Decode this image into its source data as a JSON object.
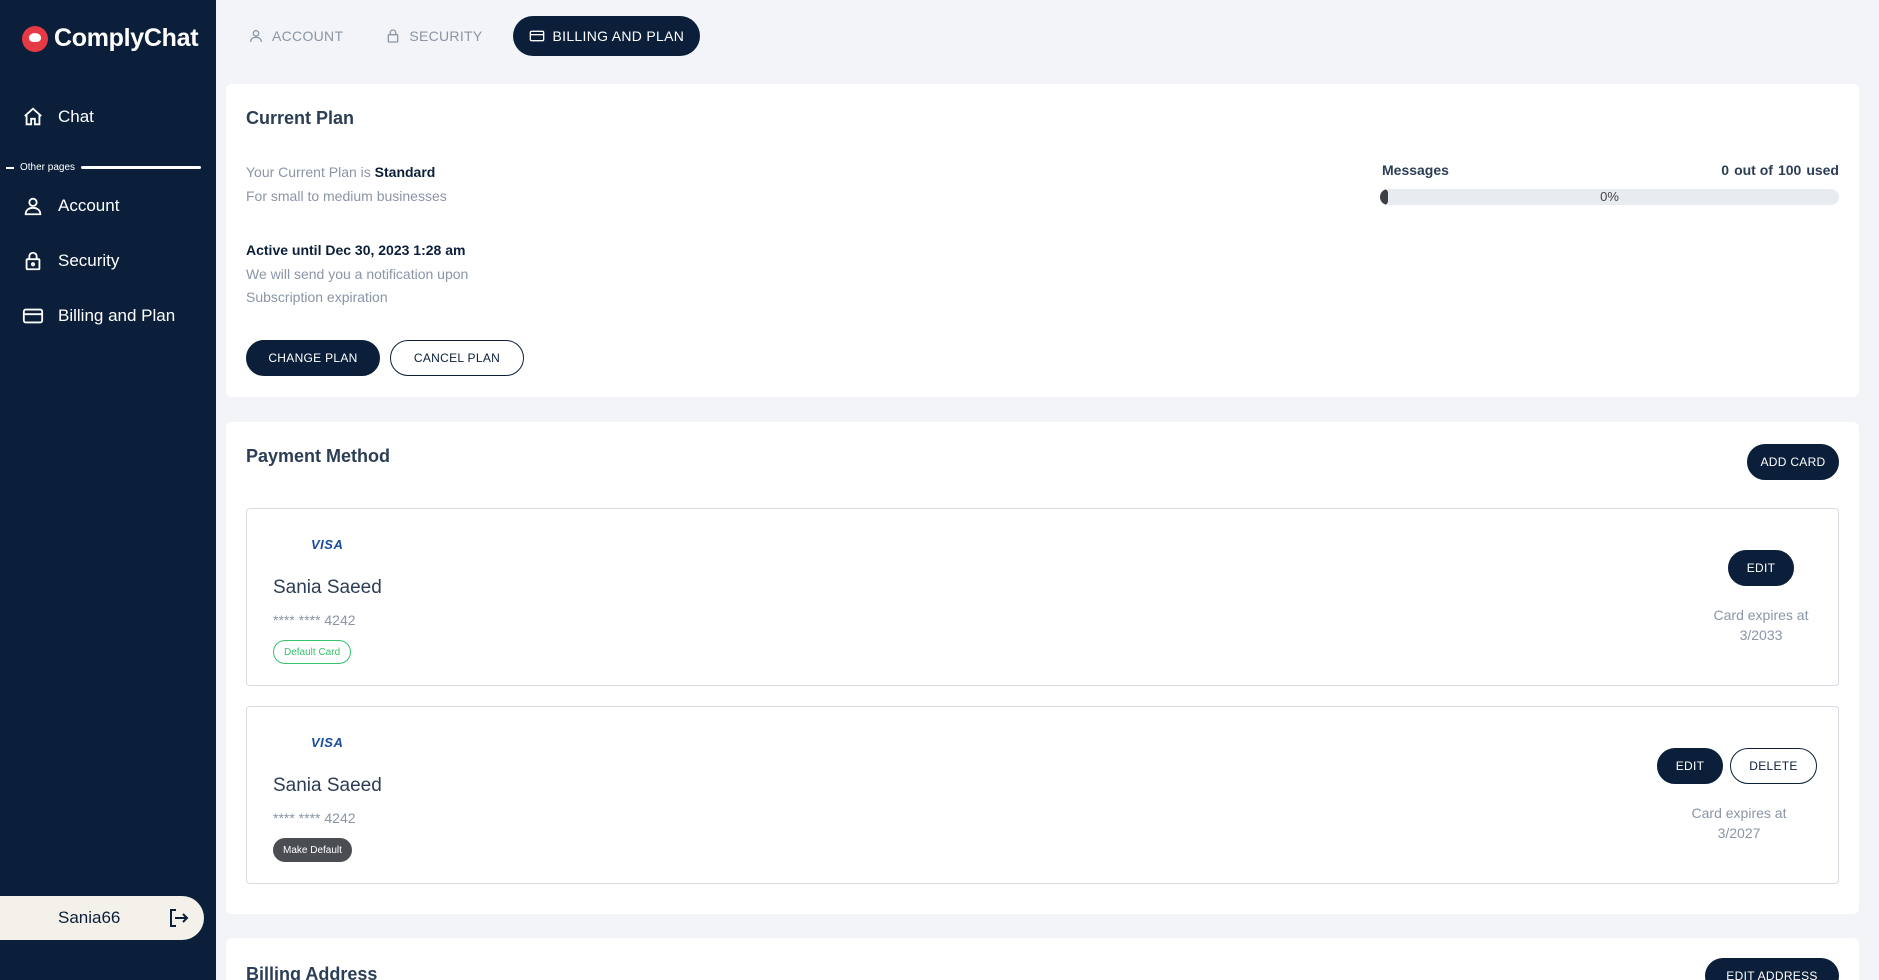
{
  "app": {
    "name": "ComplyChat"
  },
  "sidebar": {
    "items": [
      {
        "label": "Chat"
      },
      {
        "label": "Account"
      },
      {
        "label": "Security"
      },
      {
        "label": "Billing and Plan"
      }
    ],
    "separator_label": "Other pages",
    "username": "Sania66"
  },
  "tabs": [
    {
      "label": "ACCOUNT"
    },
    {
      "label": "SECURITY"
    },
    {
      "label": "BILLING AND PLAN",
      "active": true
    }
  ],
  "current_plan": {
    "title": "Current Plan",
    "plan_prefix": "Your Current Plan is ",
    "plan_name": "Standard",
    "plan_desc": "For small to medium businesses",
    "active_until": "Active until Dec 30, 2023 1:28 am",
    "notify_line1": "We will send you a notification upon",
    "notify_line2": "Subscription expiration",
    "change_label": "CHANGE PLAN",
    "cancel_label": "CANCEL PLAN",
    "usage": {
      "label": "Messages",
      "used": "0",
      "out_of_label": "out of",
      "total": "100",
      "used_label": "used",
      "percent_text": "0%",
      "percent": 0
    }
  },
  "payment_method": {
    "title": "Payment Method",
    "add_label": "ADD CARD",
    "cards": [
      {
        "brand": "VISA",
        "holder": "Sania Saeed",
        "number": "**** **** 4242",
        "badge": "Default Card",
        "edit_label": "EDIT",
        "expires_label": "Card expires at",
        "expires": "3/2033"
      },
      {
        "brand": "VISA",
        "holder": "Sania Saeed",
        "number": "**** **** 4242",
        "badge": "Make Default",
        "edit_label": "EDIT",
        "delete_label": "DELETE",
        "expires_label": "Card expires at",
        "expires": "3/2027"
      }
    ]
  },
  "billing_address": {
    "title": "Billing Address",
    "edit_label": "EDIT ADDRESS"
  }
}
